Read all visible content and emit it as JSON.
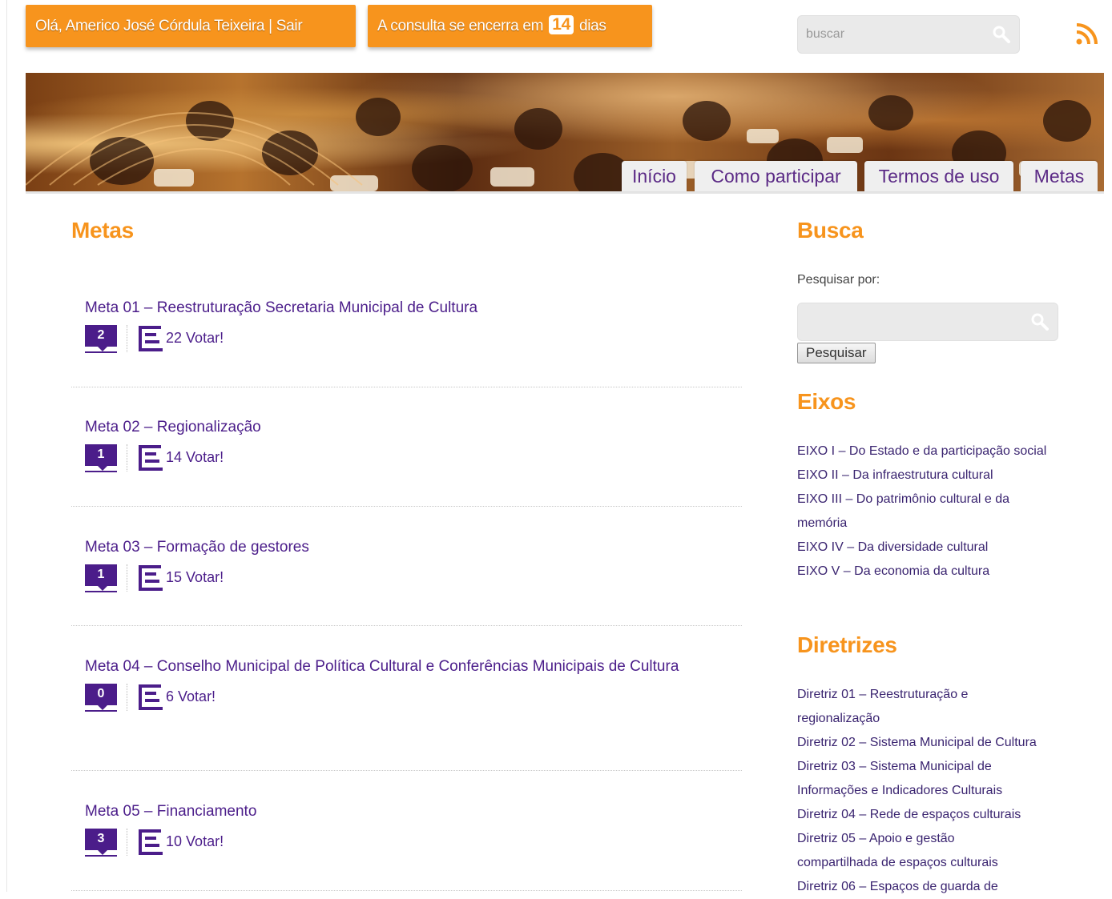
{
  "topbar": {
    "user_greeting": "Olá, Americo José Córdula Teixeira | Sair",
    "countdown_prefix": "A consulta se encerra em",
    "countdown_days": "14",
    "countdown_suffix": "dias",
    "search_placeholder": "buscar"
  },
  "icons": {
    "search": "magnifier-icon",
    "feed": "rss-icon",
    "comments": "comment-bubble-icon",
    "votes": "bar-list-icon"
  },
  "colors": {
    "accent_orange": "#f7941d",
    "link_purple": "#4b1d8a"
  },
  "nav": {
    "tabs": [
      "Início",
      "Como participar",
      "Termos de uso",
      "Metas"
    ]
  },
  "main": {
    "title": "Metas",
    "metas": [
      {
        "title": "Meta 01 – Reestruturação Secretaria Municipal de Cultura",
        "comments": "2",
        "votes": "22",
        "vote_label": "Votar!"
      },
      {
        "title": "Meta 02 – Regionalização",
        "comments": "1",
        "votes": "14",
        "vote_label": "Votar!"
      },
      {
        "title": "Meta 03 – Formação de gestores",
        "comments": "1",
        "votes": "15",
        "vote_label": "Votar!"
      },
      {
        "title": "Meta 04 – Conselho Municipal de Política Cultural e Conferências Municipais de Cultura",
        "comments": "0",
        "votes": "6",
        "vote_label": "Votar!"
      },
      {
        "title": "Meta 05 – Financiamento",
        "comments": "3",
        "votes": "10",
        "vote_label": "Votar!"
      }
    ]
  },
  "sidebar": {
    "search_title": "Busca",
    "search_label": "Pesquisar por:",
    "search_button": "Pesquisar",
    "eixos_title": "Eixos",
    "eixos": [
      "EIXO I – Do Estado e da participação social",
      "EIXO II – Da infraestrutura cultural",
      "EIXO III – Do patrimônio cultural e da memória",
      "EIXO IV – Da diversidade cultural",
      "EIXO V – Da economia da cultura"
    ],
    "diretrizes_title": "Diretrizes",
    "diretrizes": [
      "Diretriz 01 – Reestruturação e regionalização",
      "Diretriz 02 – Sistema Municipal de Cultura",
      "Diretriz 03 – Sistema Municipal de Informações e Indicadores Culturais",
      "Diretriz 04 – Rede de espaços culturais",
      "Diretriz 05 – Apoio e gestão compartilhada de espaços culturais",
      "Diretriz 06 – Espaços de guarda de"
    ]
  }
}
